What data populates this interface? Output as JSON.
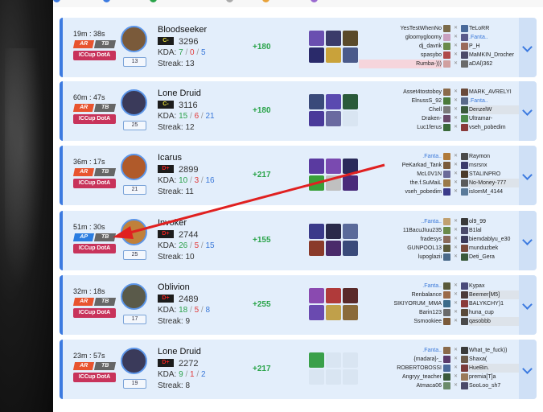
{
  "colors": {
    "accent": "#3c7ae0",
    "card_bg": "#e3eefb",
    "gain": "#2aa44a",
    "league": "#c8335b",
    "arrow": "#e02020"
  },
  "matches": [
    {
      "time": "19m : 38s",
      "mode": "AR",
      "tb": "TB",
      "league": "ICCup DotA",
      "level": "13",
      "hero": "Bloodseeker",
      "rank": "C-",
      "rank_color": "yellow",
      "points": "3296",
      "kda": {
        "label": "KDA: ",
        "k": "7",
        "d": "0",
        "a": "5"
      },
      "streak": "Streak: 13",
      "delta": "+180",
      "items": [
        "#6a4fb0",
        "#3b3b6a",
        "#5a4a2a",
        "#2a2a6a",
        "#c9a23a",
        "#4a5a8a"
      ],
      "left_players": [
        {
          "name": "YesTestWhenNo"
        },
        {
          "name": "gloomygloomy"
        },
        {
          "name": "dj_davrik"
        },
        {
          "name": "spasybo"
        },
        {
          "name": "Rumba-)))",
          "hl": true
        }
      ],
      "right_players": [
        {
          "name": "TeLoRR"
        },
        {
          "name": ".Fanta..",
          "blue": true
        },
        {
          "name": "P_H"
        },
        {
          "name": "MaMKIN_Drocher"
        },
        {
          "name": "aDAl)362"
        }
      ],
      "icons": [
        [
          "#7a6a4a",
          "#4a6a9a"
        ],
        [
          "#c9a0c0",
          "#5a5a8a"
        ],
        [
          "#6a8a4a",
          "#9a6a5a"
        ],
        [
          "#b04a4a",
          "#4a4a6a"
        ],
        [
          "#d0a0a0",
          "#6a6a6a"
        ]
      ]
    },
    {
      "time": "60m : 47s",
      "mode": "AR",
      "tb": "TB",
      "league": "ICCup DotA",
      "level": "25",
      "hero": "Lone Druid",
      "rank": "C-",
      "rank_color": "yellow",
      "points": "3116",
      "kda": {
        "label": "KDA: ",
        "k": "15",
        "d": "6",
        "a": "21"
      },
      "streak": "Streak: 12",
      "delta": "+180",
      "items": [
        "#3a4a7a",
        "#5a4ab0",
        "#2a5a3a",
        "#4a3a9a",
        "#6a6aa0",
        "empty"
      ],
      "left_players": [
        {
          "name": "Asset4tostoboy"
        },
        {
          "name": "ElnussS_92"
        },
        {
          "name": "Chell"
        },
        {
          "name": "Draken-"
        },
        {
          "name": "Luc1ferus"
        }
      ],
      "right_players": [
        {
          "name": "MARK_AVRELYI"
        },
        {
          "name": ".Fanta..",
          "blue": true
        },
        {
          "name": "DenzelW",
          "hl": true
        },
        {
          "name": "Ultramar-"
        },
        {
          "name": "vseh_pobedim"
        }
      ],
      "icons": [
        [
          "#8a6a4a",
          "#6a4a3a"
        ],
        [
          "#4a7a3a",
          "#5a6a8a"
        ],
        [
          "#7a7a7a",
          "#3a5a3a"
        ],
        [
          "#6a4a6a",
          "#4a8a4a"
        ],
        [
          "#3a6a3a",
          "#8a3a3a"
        ]
      ]
    },
    {
      "time": "36m : 17s",
      "mode": "AR",
      "tb": "TB",
      "league": "ICCup DotA",
      "level": "21",
      "hero": "Icarus",
      "rank": "D+",
      "rank_color": "red",
      "points": "2899",
      "kda": {
        "label": "KDA: ",
        "k": "10",
        "d": "3",
        "a": "16"
      },
      "streak": "Streak: 11",
      "delta": "+217",
      "items": [
        "#5a3aa0",
        "#7a4ab0",
        "#2a2a5a",
        "#3aa03a",
        "#c0c0c0",
        "#4a2a7a"
      ],
      "left_players": [
        {
          "name": ".Fanta..",
          "blue": true
        },
        {
          "name": "PeKarkad_Tank"
        },
        {
          "name": "McL0V1N"
        },
        {
          "name": "the.f.SuMaiL"
        },
        {
          "name": "vseh_pobedim"
        }
      ],
      "right_players": [
        {
          "name": "Raymon"
        },
        {
          "name": "msrsnx"
        },
        {
          "name": "STALINPRO"
        },
        {
          "name": "No-Money-777",
          "hl": true
        },
        {
          "name": "isIomM_4144"
        }
      ],
      "icons": [
        [
          "#b07a3a",
          "#4a4a4a"
        ],
        [
          "#7a5a3a",
          "#3a3a6a"
        ],
        [
          "#6a6a9a",
          "#4a3a2a"
        ],
        [
          "#9a7a4a",
          "#5a5a5a"
        ],
        [
          "#3a3a8a",
          "#5a7a9a"
        ]
      ]
    },
    {
      "time": "51m : 30s",
      "mode": "AP",
      "tb": "TB",
      "league": "ICCup DotA",
      "level": "25",
      "hero": "Invoker",
      "rank": "D+",
      "rank_color": "red",
      "points": "2744",
      "kda": {
        "label": "KDA: ",
        "k": "26",
        "d": "5",
        "a": "15"
      },
      "streak": "Streak: 10",
      "delta": "+155",
      "items": [
        "#3a3a8a",
        "#2a2a4a",
        "#5a6a9a",
        "#8a3a2a",
        "#4a2a6a",
        "#3a4a7a"
      ],
      "left_players": [
        {
          "name": "..Fanta..",
          "blue": true
        },
        {
          "name": "11BacuJIuu235"
        },
        {
          "name": "fradesys"
        },
        {
          "name": "GUNPOOL13"
        },
        {
          "name": "lupoglazii"
        }
      ],
      "right_players": [
        {
          "name": "ol9_99"
        },
        {
          "name": "B1lal"
        },
        {
          "name": "biemdablyu_e30"
        },
        {
          "name": "munduzbek"
        },
        {
          "name": "Deti_Gera"
        }
      ],
      "icons": [
        [
          "#c0a070",
          "#3a3a3a"
        ],
        [
          "#6a8a4a",
          "#4a4a6a"
        ],
        [
          "#8a6a5a",
          "#3a3a5a"
        ],
        [
          "#5a5a3a",
          "#7a4a3a"
        ],
        [
          "#4a6a8a",
          "#3a5a3a"
        ]
      ]
    },
    {
      "time": "32m : 18s",
      "mode": "AR",
      "tb": "TB",
      "league": "ICCup DotA",
      "level": "17",
      "hero": "Oblivion",
      "rank": "D+",
      "rank_color": "red",
      "points": "2489",
      "kda": {
        "label": "KDA: ",
        "k": "18",
        "d": "5",
        "a": "8"
      },
      "streak": "Streak: 9",
      "delta": "+255",
      "items": [
        "#8a4ab0",
        "#b03a3a",
        "#5a2a2a",
        "#6a4ab0",
        "#c0a04a",
        "#8a6a3a"
      ],
      "left_players": [
        {
          "name": ".Fanta..",
          "blue": true
        },
        {
          "name": "Renbalance"
        },
        {
          "name": "SIKIYORUM_MMA"
        },
        {
          "name": "Barin123"
        },
        {
          "name": "Ssmookiee"
        }
      ],
      "right_players": [
        {
          "name": "Kypax"
        },
        {
          "name": "Beemer[M5]",
          "hl": true
        },
        {
          "name": "BALYKCHY)1"
        },
        {
          "name": "huna_cup"
        },
        {
          "name": "qasobbb",
          "hl": true
        }
      ],
      "icons": [
        [
          "#5a5a3a",
          "#4a4a7a"
        ],
        [
          "#9a6a4a",
          "#4a3a3a"
        ],
        [
          "#3a6a8a",
          "#8a3a3a"
        ],
        [
          "#6a6a6a",
          "#5a4a3a"
        ],
        [
          "#7a5a3a",
          "#4a4a4a"
        ]
      ]
    },
    {
      "time": "23m : 57s",
      "mode": "AR",
      "tb": "TB",
      "league": "ICCup DotA",
      "level": "19",
      "hero": "Lone Druid",
      "rank": "D+",
      "rank_color": "red",
      "points": "2272",
      "kda": {
        "label": "KDA: ",
        "k": "9",
        "d": "1",
        "a": "2"
      },
      "streak": "Streak: 8",
      "delta": "+217",
      "items": [
        "#3aa04a",
        "empty",
        "empty",
        "empty",
        "empty",
        "empty"
      ],
      "left_players": [
        {
          "name": ".Fanta..",
          "blue": true
        },
        {
          "name": "{madara}-_"
        },
        {
          "name": "ROBERTOBOSSI"
        },
        {
          "name": "Angryy_teacher"
        },
        {
          "name": "Atmaca06"
        }
      ],
      "right_players": [
        {
          "name": "What_te_fuck))"
        },
        {
          "name": "Shaxa("
        },
        {
          "name": "HueBin.",
          "hl": true
        },
        {
          "name": "premia[T]a"
        },
        {
          "name": "SooLoo_sh7"
        }
      ],
      "icons": [
        [
          "#8a6a4a",
          "#3a3a3a"
        ],
        [
          "#5a3a6a",
          "#6a5a4a"
        ],
        [
          "#4a6a9a",
          "#7a3a3a"
        ],
        [
          "#3a5a3a",
          "#9a7a5a"
        ],
        [
          "#6a8a6a",
          "#4a4a6a"
        ]
      ]
    }
  ],
  "annotation": {
    "type": "red-arrow",
    "from": "Icarus row players list",
    "to": "51m : 30s match AP badge"
  }
}
